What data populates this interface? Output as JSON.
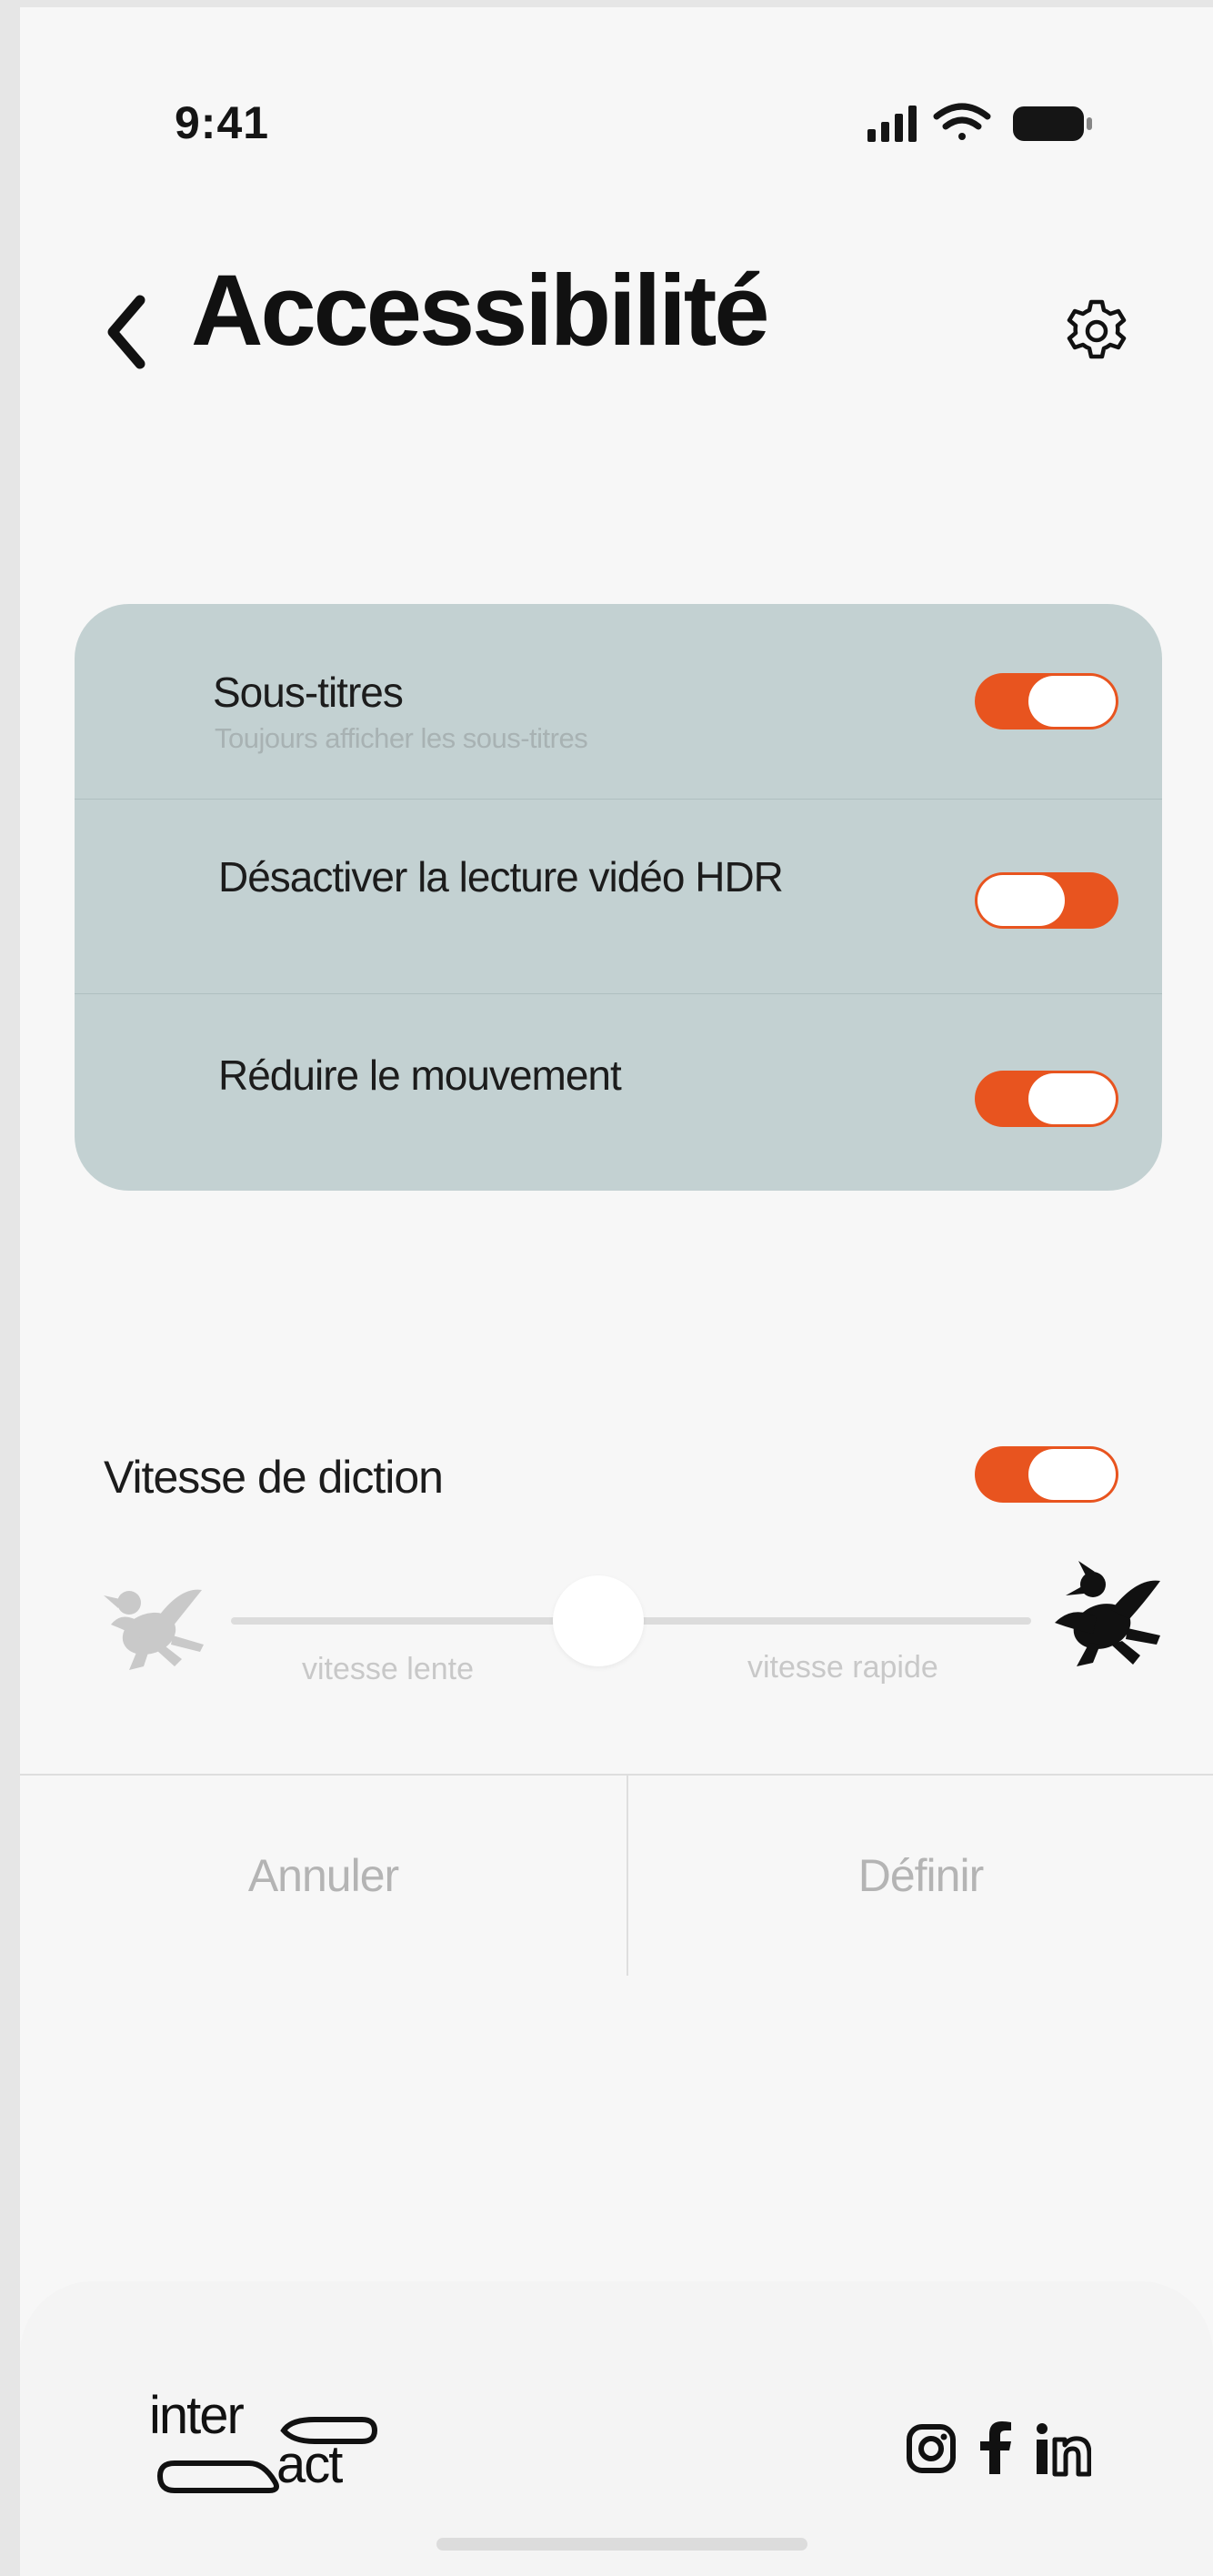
{
  "status_bar": {
    "time": "9:41",
    "icons": [
      "signal-icon",
      "wifi-icon",
      "battery-icon"
    ]
  },
  "header": {
    "back_icon": "chevron-left-icon",
    "title": "Accessibilité",
    "settings_icon": "gear-icon"
  },
  "settings": {
    "items": [
      {
        "label": "Sous-titres",
        "sublabel": "Toujours afficher les sous-titres",
        "enabled": true
      },
      {
        "label": "Désactiver la lecture vidéo HDR",
        "enabled": false
      },
      {
        "label": "Réduire le mouvement",
        "enabled": true
      }
    ]
  },
  "speech_rate": {
    "label": "Vitesse de diction",
    "enabled": true,
    "slow_label": "vitesse lente",
    "fast_label": "vitesse rapide",
    "value": 0.5,
    "slow_icon": "bird-slow-icon",
    "fast_icon": "bird-fast-icon"
  },
  "actions": {
    "cancel": "Annuler",
    "set": "Définir"
  },
  "footer": {
    "logo_top": "inter",
    "logo_bottom": "act",
    "social_icons": [
      "instagram-icon",
      "facebook-icon",
      "linkedin-icon"
    ]
  },
  "colors": {
    "accent": "#e8541f",
    "card_background": "#c3d1d2",
    "screen_background": "#f7f7f7",
    "muted_text": "#b4b4b4"
  }
}
